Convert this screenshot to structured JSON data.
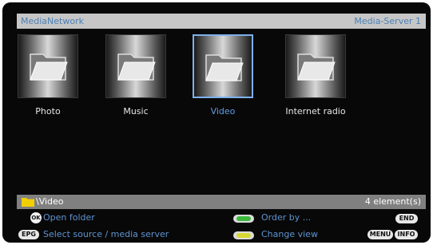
{
  "header": {
    "app_title": "MediaNetwork",
    "server_name": "Media-Server 1"
  },
  "folders": [
    {
      "label": "Photo",
      "selected": false
    },
    {
      "label": "Music",
      "selected": false
    },
    {
      "label": "Video",
      "selected": true
    },
    {
      "label": "Internet radio",
      "selected": false
    }
  ],
  "path_bar": {
    "path": "\\Video",
    "count": "4 element(s)"
  },
  "hints": {
    "ok_key": "OK",
    "open_folder": "Open folder",
    "epg_key": "EPG",
    "select_source": "Select source / media server",
    "order_by": "Order by ...",
    "change_view": "Change view",
    "end_key": "END",
    "menu_key": "MENU",
    "info_key": "INFO"
  },
  "colors": {
    "accent_blue": "#5f9fe6",
    "green_button": "#3db83d",
    "yellow_button": "#d8d834",
    "folder_yellow": "#f2d000"
  }
}
